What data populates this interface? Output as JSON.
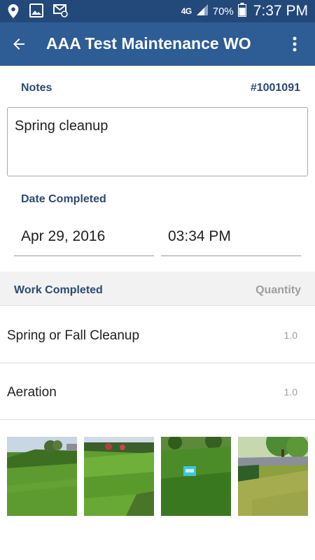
{
  "status_bar": {
    "network": "4G",
    "battery": "70%",
    "time": "7:37 PM",
    "icons": [
      "location-icon",
      "image-icon",
      "mail-icon",
      "signal-icon",
      "battery-icon"
    ]
  },
  "app_bar": {
    "title": "AAA Test Maintenance WO",
    "back_icon": "arrow-back-icon",
    "menu_icon": "more-vert-icon"
  },
  "notes": {
    "label": "Notes",
    "wo_number": "#1001091",
    "text": "Spring cleanup"
  },
  "date_completed": {
    "label": "Date Completed",
    "date": "Apr 29, 2016",
    "time": "03:34 PM"
  },
  "work_completed": {
    "label": "Work Completed",
    "quantity_label": "Quantity",
    "items": [
      {
        "name": "Spring or Fall Cleanup",
        "quantity": "1.0"
      },
      {
        "name": "Aeration",
        "quantity": "1.0"
      }
    ]
  },
  "photos": [
    {
      "name": "photo-lawn-slope"
    },
    {
      "name": "photo-mowed-lawn"
    },
    {
      "name": "photo-lawn-sign"
    },
    {
      "name": "photo-tree-lawn"
    }
  ],
  "colors": {
    "status_bar": "#23487a",
    "app_bar": "#2e5c94",
    "label": "#2b4a73",
    "secondary": "#9e9e9e"
  }
}
